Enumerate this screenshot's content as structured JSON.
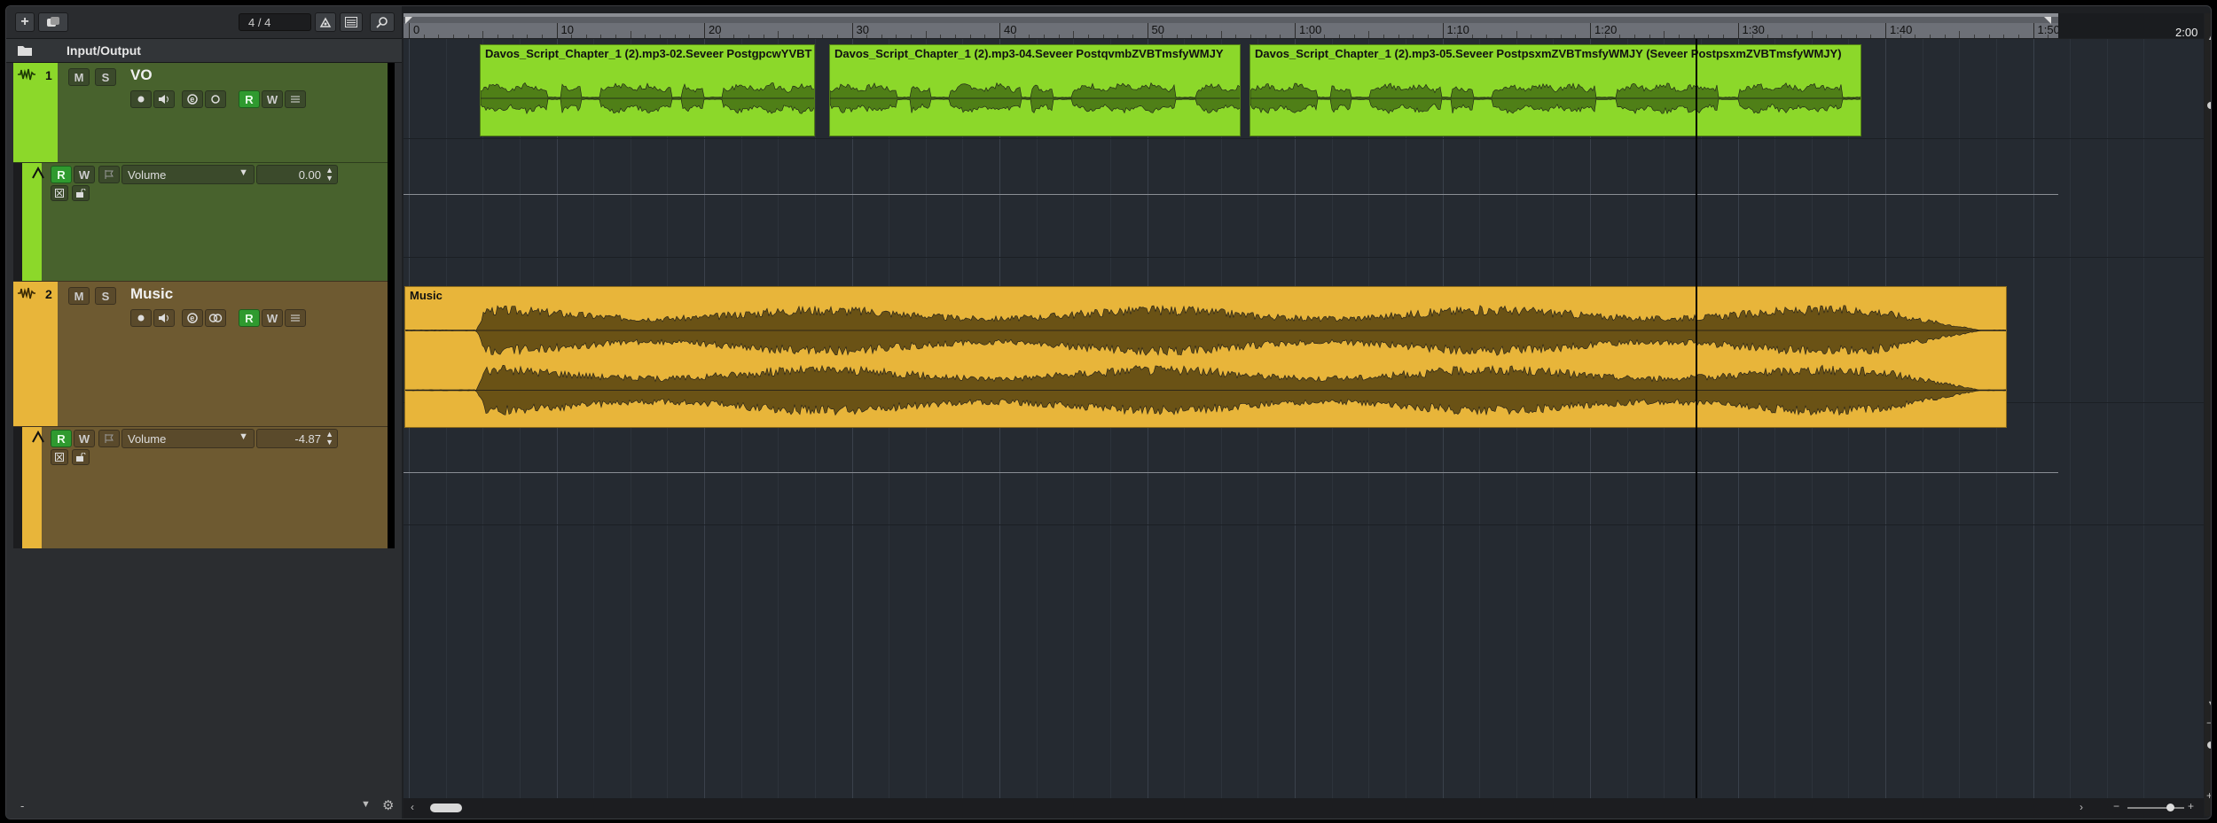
{
  "toolbar": {
    "add_track_label": "+",
    "add_folder_label": "◙",
    "visible_tracks_label": "4 / 4",
    "search_icon": "magnifier"
  },
  "io_header": {
    "label": "Input/Output"
  },
  "tracks": [
    {
      "number": "1",
      "name": "VO",
      "mute_label": "M",
      "solo_label": "S",
      "read_label": "R",
      "write_label": "W",
      "color": "#8cd82a",
      "strip_color": "#8cd82a",
      "auto": {
        "read_label": "R",
        "write_label": "W",
        "param": "Volume",
        "value": "0.00"
      }
    },
    {
      "number": "2",
      "name": "Music",
      "mute_label": "M",
      "solo_label": "S",
      "read_label": "R",
      "write_label": "W",
      "color": "#e8b53a",
      "strip_color": "#e8b53a",
      "auto": {
        "read_label": "R",
        "write_label": "W",
        "param": "Volume",
        "value": "-4.87"
      }
    }
  ],
  "ruler": {
    "labels": [
      "0",
      "10",
      "20",
      "30",
      "40",
      "50",
      "1:00",
      "1:10",
      "1:20",
      "1:30",
      "1:40",
      "1:50"
    ],
    "end_label": "2:00"
  },
  "events": {
    "vo": [
      {
        "name": "Davos_Script_Chapter_1 (2).mp3-02.Seveer PostgpcwYVBT"
      },
      {
        "name": "Davos_Script_Chapter_1 (2).mp3-04.Seveer PostqvmbZVBTmsfyWMJY"
      },
      {
        "name": "Davos_Script_Chapter_1 (2).mp3-05.Seveer PostpsxmZVBTmsfyWMJY (Seveer PostpsxmZVBTmsfyWMJY)"
      }
    ],
    "music": [
      {
        "name": "Music"
      }
    ]
  },
  "footer": {
    "left_label": "-"
  },
  "colors": {
    "vo": "#8cd82a",
    "music": "#e8b53a",
    "grid_bg": "#252a31"
  }
}
